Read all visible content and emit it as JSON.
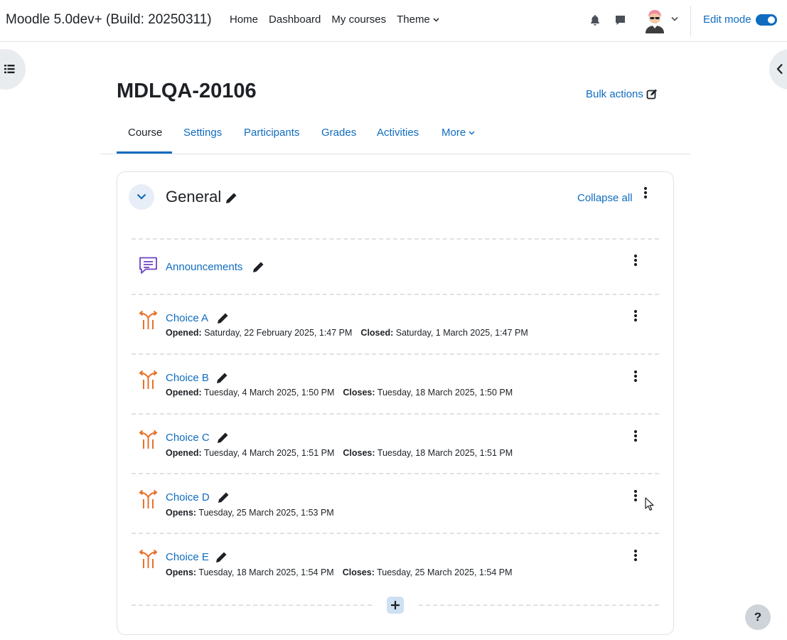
{
  "navbar": {
    "brand": "Moodle 5.0dev+ (Build: 20250311)",
    "items": [
      {
        "label": "Home"
      },
      {
        "label": "Dashboard"
      },
      {
        "label": "My courses"
      },
      {
        "label": "Theme"
      }
    ],
    "edit_mode_label": "Edit mode",
    "edit_mode_on": true
  },
  "course": {
    "title": "MDLQA-20106",
    "bulk_actions": "Bulk actions"
  },
  "tabs": [
    {
      "label": "Course",
      "active": true
    },
    {
      "label": "Settings"
    },
    {
      "label": "Participants"
    },
    {
      "label": "Grades"
    },
    {
      "label": "Activities"
    },
    {
      "label": "More"
    }
  ],
  "section": {
    "title": "General",
    "collapse_all": "Collapse all"
  },
  "activities": [
    {
      "name": "Announcements",
      "icon": "forum-icon"
    },
    {
      "name": "Choice A",
      "icon": "choice-icon",
      "dates": [
        {
          "label": "Opened:",
          "value": "Saturday, 22 February 2025, 1:47 PM"
        },
        {
          "label": "Closed:",
          "value": "Saturday, 1 March 2025, 1:47 PM"
        }
      ]
    },
    {
      "name": "Choice B",
      "icon": "choice-icon",
      "dates": [
        {
          "label": "Opened:",
          "value": "Tuesday, 4 March 2025, 1:50 PM"
        },
        {
          "label": "Closes:",
          "value": "Tuesday, 18 March 2025, 1:50 PM"
        }
      ]
    },
    {
      "name": "Choice C",
      "icon": "choice-icon",
      "dates": [
        {
          "label": "Opened:",
          "value": "Tuesday, 4 March 2025, 1:51 PM"
        },
        {
          "label": "Closes:",
          "value": "Tuesday, 18 March 2025, 1:51 PM"
        }
      ]
    },
    {
      "name": "Choice D",
      "icon": "choice-icon",
      "dates": [
        {
          "label": "Opens:",
          "value": "Tuesday, 25 March 2025, 1:53 PM"
        }
      ]
    },
    {
      "name": "Choice E",
      "icon": "choice-icon",
      "dates": [
        {
          "label": "Opens:",
          "value": "Tuesday, 18 March 2025, 1:54 PM"
        },
        {
          "label": "Closes:",
          "value": "Tuesday, 25 March 2025, 1:54 PM"
        }
      ]
    }
  ],
  "help": "?",
  "colors": {
    "link": "#0f6cbf",
    "choice_icon": "#e8702a",
    "forum_icon": "#6f42c1"
  }
}
